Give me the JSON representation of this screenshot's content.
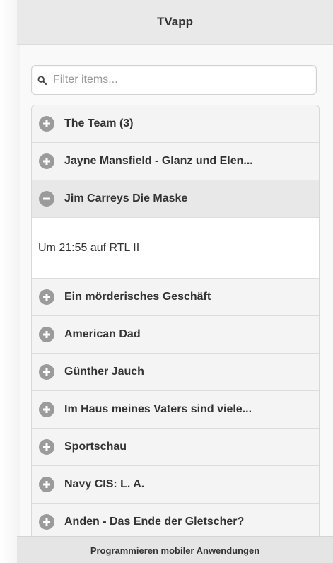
{
  "header": {
    "title": "TVapp"
  },
  "search": {
    "placeholder": "Filter items..."
  },
  "items": [
    {
      "label": "The Team (3)",
      "state": "collapsed"
    },
    {
      "label": "Jayne Mansfield - Glanz und Elen...",
      "state": "collapsed"
    },
    {
      "label": "Jim Carreys Die Maske",
      "state": "expanded",
      "content": "Um 21:55 auf RTL II"
    },
    {
      "label": "Ein mörderisches Geschäft",
      "state": "collapsed"
    },
    {
      "label": "American Dad",
      "state": "collapsed"
    },
    {
      "label": "Günther Jauch",
      "state": "collapsed"
    },
    {
      "label": "Im Haus meines Vaters sind viele...",
      "state": "collapsed"
    },
    {
      "label": "Sportschau",
      "state": "collapsed"
    },
    {
      "label": "Navy CIS: L. A.",
      "state": "collapsed"
    },
    {
      "label": "Anden - Das Ende der Gletscher?",
      "state": "collapsed"
    }
  ],
  "footer": {
    "text": "Programmieren mobiler Anwendungen"
  },
  "icons": {
    "collapsed": "plus-circle-icon",
    "expanded": "minus-circle-icon",
    "search": "search-icon"
  },
  "colors": {
    "header_bg": "#e9e9e9",
    "icon_gray": "#9b9b9b"
  }
}
